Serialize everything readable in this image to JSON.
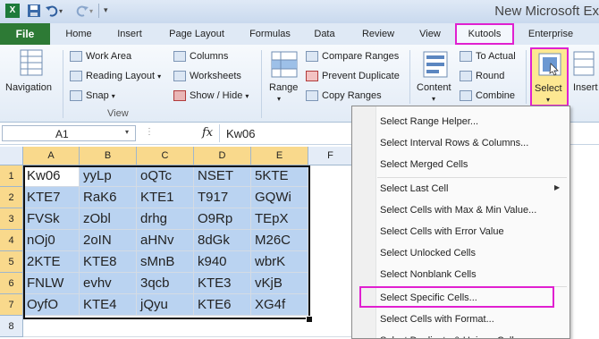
{
  "window": {
    "title": "New Microsoft Ex"
  },
  "tabs": [
    "File",
    "Home",
    "Insert",
    "Page Layout",
    "Formulas",
    "Data",
    "Review",
    "View",
    "Kutools",
    "Enterprise"
  ],
  "ribbon": {
    "navigation": "Navigation",
    "work_area": "Work Area",
    "reading_layout": "Reading Layout",
    "snap": "Snap",
    "columns": "Columns",
    "worksheets": "Worksheets",
    "show_hide": "Show / Hide",
    "group_view": "View",
    "range": "Range",
    "compare_ranges": "Compare Ranges",
    "prevent_duplicate": "Prevent Duplicate",
    "copy_ranges": "Copy Ranges",
    "content": "Content",
    "to_actual": "To Actual",
    "round": "Round",
    "combine": "Combine",
    "select": "Select",
    "insert": "Insert"
  },
  "formula_bar": {
    "name_box": "A1",
    "fx": "fx",
    "value": "Kw06"
  },
  "grid": {
    "columns": [
      "A",
      "B",
      "C",
      "D",
      "E",
      "F"
    ],
    "rows": [
      "1",
      "2",
      "3",
      "4",
      "5",
      "6",
      "7",
      "8"
    ],
    "cells": [
      [
        "Kw06",
        "yyLp",
        "oQTc",
        "NSET",
        "5KTE"
      ],
      [
        "KTE7",
        "RaK6",
        "KTE1",
        "T917",
        "GQWi"
      ],
      [
        "FVSk",
        "zObl",
        "drhg",
        "O9Rp",
        "TEpX"
      ],
      [
        "nOj0",
        "2oIN",
        "aHNv",
        "8dGk",
        "M26C"
      ],
      [
        "2KTE",
        "KTE8",
        "sMnB",
        "k940",
        "wbrK"
      ],
      [
        "FNLW",
        "evhv",
        "3qcb",
        "KTE3",
        "vKjB"
      ],
      [
        "OyfO",
        "KTE4",
        "jQyu",
        "KTE6",
        "XG4f"
      ]
    ]
  },
  "menu": {
    "items": [
      "Select Range Helper...",
      "Select Interval Rows & Columns...",
      "Select Merged Cells",
      "Select Last Cell",
      "Select Cells with Max & Min Value...",
      "Select Cells with Error Value",
      "Select Unlocked Cells",
      "Select Nonblank Cells",
      "Select Specific Cells...",
      "Select Cells with Format...",
      "Select Duplicate & Unique Cells..."
    ]
  },
  "colors": {
    "highlight": "#e020d0",
    "selection_fill": "#bad3f1",
    "file_tab": "#2d7a35",
    "select_button": "#fde892"
  }
}
